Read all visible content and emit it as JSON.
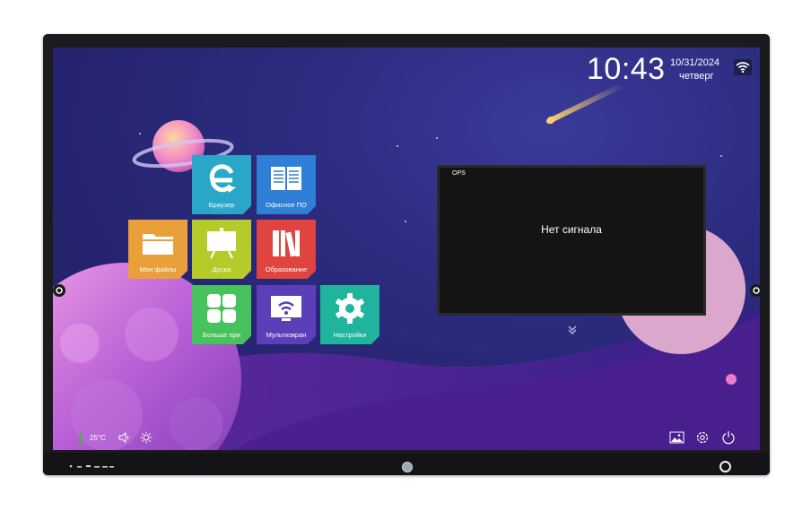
{
  "status_bar": {
    "time": "10:43",
    "date": "10/31/2024",
    "weekday": "четверг",
    "wifi_icon": "wifi-icon"
  },
  "apps": [
    {
      "label": "Браузер",
      "icon": "browser-icon",
      "color": "#2aa6c9"
    },
    {
      "label": "Офисное ПО",
      "icon": "book-icon",
      "color": "#2f7fd6"
    },
    {
      "label": "Мои файлы",
      "icon": "folder-icon",
      "color": "#e9a03a"
    },
    {
      "label": "Доска",
      "icon": "whiteboard-icon",
      "color": "#b4cb2a"
    },
    {
      "label": "Образование",
      "icon": "books-icon",
      "color": "#e0443f"
    },
    {
      "label": "Больше при",
      "icon": "apps-grid-icon",
      "color": "#48c25c"
    },
    {
      "label": "Мультиэкран",
      "icon": "cast-icon",
      "color": "#5b3fb8"
    },
    {
      "label": "Настройки",
      "icon": "gear-icon",
      "color": "#1fb59c"
    }
  ],
  "ops_window": {
    "title": "OPS",
    "message": "Нет сигнала"
  },
  "bottom_left": {
    "temperature": "25°C"
  }
}
